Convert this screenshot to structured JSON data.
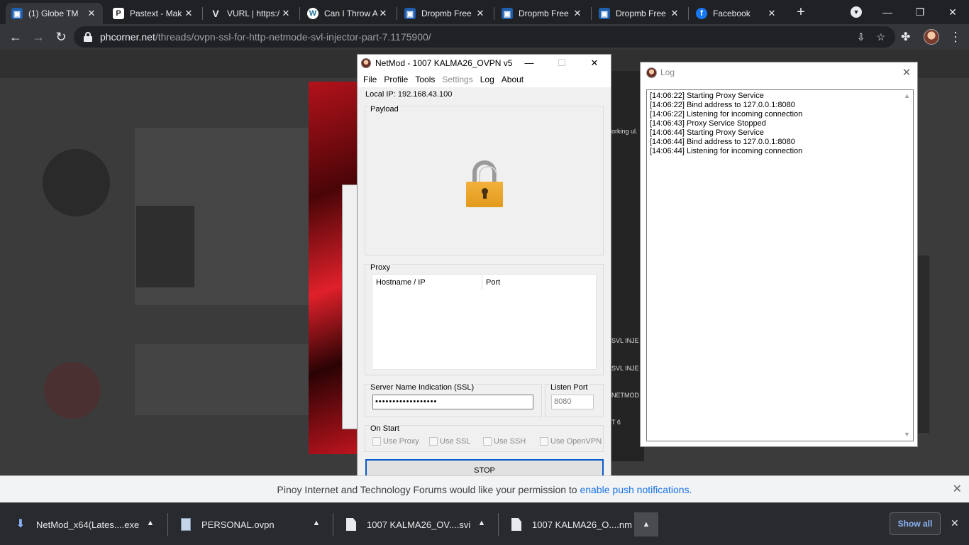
{
  "browser": {
    "tabs": [
      {
        "title": "(1) Globe TM",
        "icon": "virtualbox-icon",
        "active": true
      },
      {
        "title": "Pastext - Mak",
        "icon": "pastext-icon"
      },
      {
        "title": "VURL | https:/",
        "icon": "vurl-icon"
      },
      {
        "title": "Can I Throw A",
        "icon": "wordpress-icon"
      },
      {
        "title": "Dropmb Free",
        "icon": "virtualbox-icon"
      },
      {
        "title": "Dropmb Free",
        "icon": "virtualbox-icon"
      },
      {
        "title": "Dropmb Free",
        "icon": "virtualbox-icon"
      },
      {
        "title": "Facebook",
        "icon": "facebook-icon"
      }
    ],
    "url_host": "phcorner.net",
    "url_path": "/threads/ovpn-ssl-for-http-netmode-svl-injector-part-7.1175900/"
  },
  "page_side_text": [
    "orking ul.",
    "SVL INJE",
    "SVL INJE",
    "NETMOD",
    "T 6"
  ],
  "netmod": {
    "title": "NetMod - 1007 KALMA26_OVPN v5",
    "menu": [
      {
        "label": "File",
        "enabled": true
      },
      {
        "label": "Profile",
        "enabled": true
      },
      {
        "label": "Tools",
        "enabled": true
      },
      {
        "label": "Settings",
        "enabled": false
      },
      {
        "label": "Log",
        "enabled": true
      },
      {
        "label": "About",
        "enabled": true
      }
    ],
    "local_ip": "Local IP: 192.168.43.100",
    "payload_label": "Payload",
    "proxy_label": "Proxy",
    "proxy_columns": [
      "Hostname / IP",
      "Port"
    ],
    "sni_label": "Server Name Indication (SSL)",
    "sni_value": "••••••••••••••••••",
    "listen_label": "Listen Port",
    "listen_placeholder": "8080",
    "onstart_label": "On Start",
    "onstart_options": [
      "Use Proxy",
      "Use SSL",
      "Use SSH",
      "Use OpenVPN"
    ],
    "stop_label": "STOP"
  },
  "log": {
    "title": "Log",
    "lines": [
      "[14:06:22] Starting Proxy Service",
      "[14:06:22] Bind address to 127.0.0.1:8080",
      "[14:06:22] Listening for incoming connection",
      "[14:06:43] Proxy Service Stopped",
      "[14:06:44] Starting Proxy Service",
      "[14:06:44] Bind address to 127.0.0.1:8080",
      "[14:06:44] Listening for incoming connection"
    ]
  },
  "notification": {
    "text": "Pinoy Internet and Technology Forums would like your permission to ",
    "link": "enable push notifications."
  },
  "downloads": {
    "items": [
      {
        "name": "NetMod_x64(Lates....exe",
        "type": "exe"
      },
      {
        "name": "PERSONAL.ovpn",
        "type": "ovpn"
      },
      {
        "name": "1007 KALMA26_OV....svi",
        "type": "file"
      },
      {
        "name": "1007 KALMA26_O....nm",
        "type": "file"
      }
    ],
    "show_all": "Show all"
  },
  "colors": {
    "accent": "#0b5ac8",
    "chrome_dark": "#202124",
    "link": "#1a73e8"
  }
}
